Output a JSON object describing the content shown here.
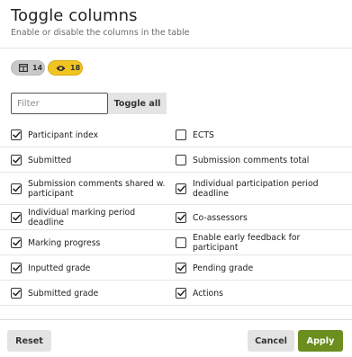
{
  "header": {
    "title": "Toggle columns",
    "subtitle": "Enable or disable the columns in the table"
  },
  "badges": {
    "hidden_count": "14",
    "hidden_icon": "table-columns-icon",
    "visible_count": "18",
    "visible_icon": "eye-icon",
    "visible_color": "#f2c422"
  },
  "filter": {
    "value": "",
    "placeholder": "Filter",
    "toggle_all_label": "Toggle all"
  },
  "columns": {
    "rows": [
      [
        {
          "label": "Participant index",
          "checked": true
        },
        {
          "label": "ECTS",
          "checked": false
        }
      ],
      [
        {
          "label": "Submitted",
          "checked": true
        },
        {
          "label": "Submission comments total",
          "checked": false
        }
      ],
      [
        {
          "label": "Submission comments shared w. participant",
          "checked": true
        },
        {
          "label": "Individual participation period deadline",
          "checked": true
        }
      ],
      [
        {
          "label": "Individual marking period deadline",
          "checked": true
        },
        {
          "label": "Co-assessors",
          "checked": true
        }
      ],
      [
        {
          "label": "Marking progress",
          "checked": true
        },
        {
          "label": "Enable early feedback for participant",
          "checked": false
        }
      ],
      [
        {
          "label": "Inputted grade",
          "checked": true
        },
        {
          "label": "Pending grade",
          "checked": true
        }
      ],
      [
        {
          "label": "Submitted grade",
          "checked": true
        },
        {
          "label": "Actions",
          "checked": true
        }
      ]
    ]
  },
  "footer": {
    "reset_label": "Reset",
    "cancel_label": "Cancel",
    "apply_label": "Apply",
    "apply_color": "#6b8e1e"
  }
}
